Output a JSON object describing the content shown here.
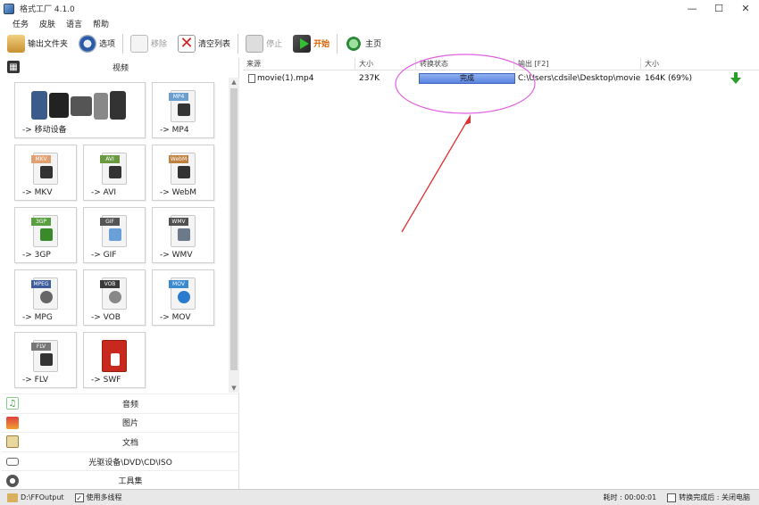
{
  "window": {
    "title": "格式工厂 4.1.0",
    "min": "—",
    "max": "☐",
    "close": "✕"
  },
  "menu": [
    "任务",
    "皮肤",
    "语言",
    "帮助"
  ],
  "toolbar": {
    "output_folder": "输出文件夹",
    "options": "选项",
    "remove": "移除",
    "clear_list": "清空列表",
    "stop": "停止",
    "start": "开始",
    "home": "主页"
  },
  "left": {
    "video_header": "视频",
    "tiles": [
      {
        "label": "-> 移动设备",
        "tag": ""
      },
      {
        "label": "-> MP4",
        "tag": "MP4",
        "tag_color": "#6a9fd0"
      },
      {
        "label": "-> MKV",
        "tag": "MKV",
        "tag_color": "#e0a070"
      },
      {
        "label": "-> AVI",
        "tag": "AVI",
        "tag_color": "#6a9a40"
      },
      {
        "label": "-> WebM",
        "tag": "WebM",
        "tag_color": "#c08040"
      },
      {
        "label": "-> 3GP",
        "tag": "3GP",
        "tag_color": "#5aa040"
      },
      {
        "label": "-> GIF",
        "tag": "GIF",
        "tag_color": "#555555"
      },
      {
        "label": "-> WMV",
        "tag": "WMV",
        "tag_color": "#505050"
      },
      {
        "label": "-> MPG",
        "tag": "MPEG",
        "tag_color": "#3c5c9c"
      },
      {
        "label": "-> VOB",
        "tag": "VOB",
        "tag_color": "#3a3a3a"
      },
      {
        "label": "-> MOV",
        "tag": "MOV",
        "tag_color": "#3a8ad0"
      },
      {
        "label": "-> FLV",
        "tag": "FLV",
        "tag_color": "#777777"
      },
      {
        "label": "-> SWF",
        "tag": "",
        "tag_color": "#c8281e"
      }
    ],
    "categories": [
      "音频",
      "图片",
      "文档",
      "光驱设备\\DVD\\CD\\ISO",
      "工具集"
    ]
  },
  "table": {
    "headers": {
      "source": "来源",
      "size": "大小",
      "status": "转换状态",
      "output": "输出 [F2]",
      "out_size": "大小"
    },
    "rows": [
      {
        "source": "movie(1).mp4",
        "size": "237K",
        "status": "完成",
        "progress": 1.0,
        "output": "C:\\Users\\cdsile\\Desktop\\movie(...",
        "out_size": "164K  (69%)"
      }
    ]
  },
  "status": {
    "output_path": "D:\\FFOutput",
    "multithread": "使用多线程",
    "multithread_checked": "✓",
    "elapsed": "耗时 : 00:00:01",
    "after_done": "转换完成后 : 关闭电脑"
  },
  "colors": {
    "annotation": "#e060e0",
    "arrow": "#e03030",
    "progress": "#5b84e0"
  }
}
